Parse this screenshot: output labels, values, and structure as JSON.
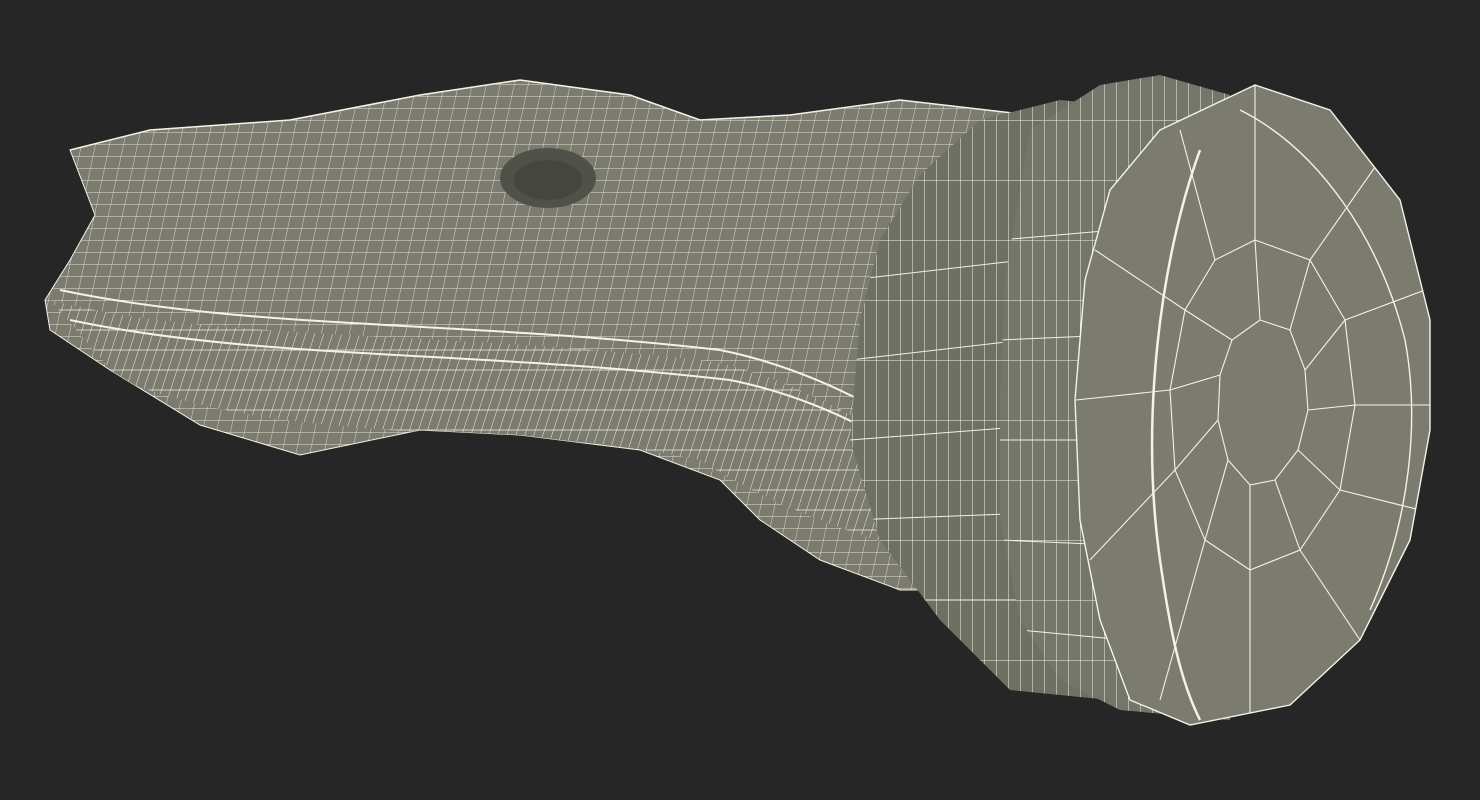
{
  "scene": {
    "background_color": "#262626",
    "model_fill_color": "#7b7c6f",
    "model_shadow_color": "#5f6055",
    "wire_color": "#f4f2e4",
    "render_mode": "wireframe-over-shaded",
    "subject": "horse-head"
  }
}
